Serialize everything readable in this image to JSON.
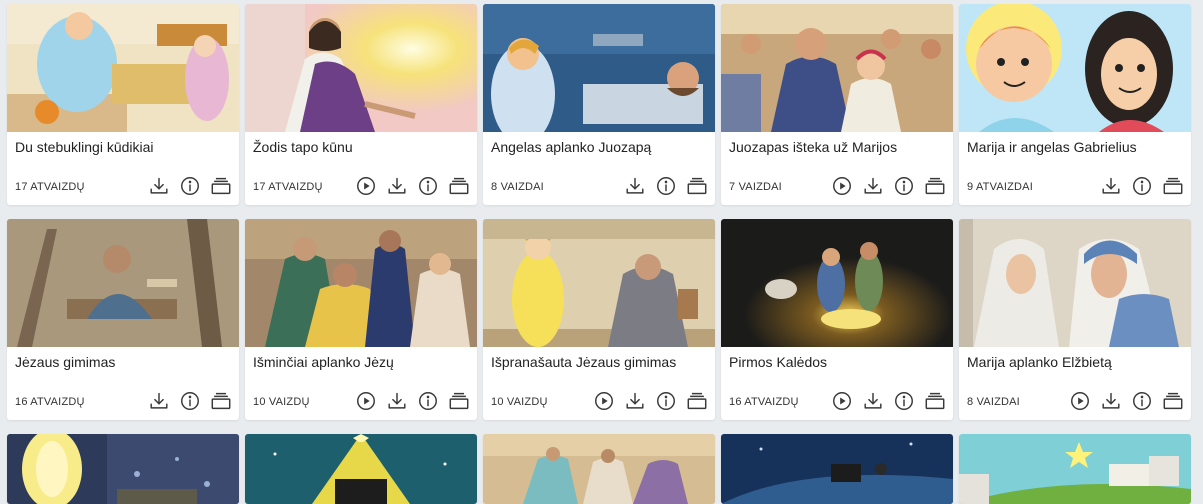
{
  "colors": {
    "background": "#e9ecef",
    "card": "#ffffff",
    "text": "#222222",
    "icon": "#3a3a3a"
  },
  "icons": {
    "play": "play-circle-icon",
    "download": "download-icon",
    "info": "info-icon",
    "collection": "add-to-collection-icon"
  },
  "cards": [
    {
      "title": "Du stebuklingi kūdikiai",
      "count": "17 ATVAIZDŲ",
      "has_play": false
    },
    {
      "title": "Žodis tapo kūnu",
      "count": "17 ATVAIZDŲ",
      "has_play": true
    },
    {
      "title": "Angelas aplanko Juozapą",
      "count": "8 VAIZDAI",
      "has_play": false
    },
    {
      "title": "Juozapas išteka už Marijos",
      "count": "7 VAIZDAI",
      "has_play": true
    },
    {
      "title": "Marija ir angelas Gabrielius",
      "count": "9 ATVAIZDAI",
      "has_play": false
    },
    {
      "title": "Jėzaus gimimas",
      "count": "16 ATVAIZDŲ",
      "has_play": false
    },
    {
      "title": "Išminčiai aplanko Jėzų",
      "count": "10 VAIZDŲ",
      "has_play": true
    },
    {
      "title": "Išpranašauta Jėzaus gimimas",
      "count": "10 VAIZDŲ",
      "has_play": true
    },
    {
      "title": "Pirmos Kalėdos",
      "count": "16 ATVAIZDŲ",
      "has_play": true
    },
    {
      "title": "Marija aplanko Elžbietą",
      "count": "8 VAIZDAI",
      "has_play": true
    }
  ]
}
